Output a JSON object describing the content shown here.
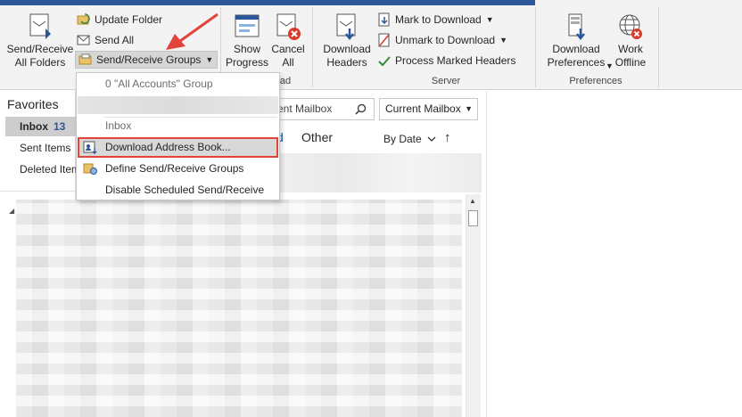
{
  "ribbon": {
    "send_receive_all": "Send/Receive\nAll Folders",
    "update_folder": "Update Folder",
    "send_all": "Send All",
    "send_receive_groups": "Send/Receive Groups",
    "send_receive_group_label_partial": "S",
    "show_progress": "Show\nProgress",
    "cancel_all": "Cancel\nAll",
    "download_group_label_partial": "ad",
    "download_headers": "Download\nHeaders",
    "mark_to_download": "Mark to Download",
    "unmark_to_download": "Unmark to Download",
    "process_marked_headers": "Process Marked Headers",
    "server_group_label": "Server",
    "download_preferences": "Download\nPreferences",
    "work_offline": "Work\nOffline",
    "preferences_group_label": "Preferences"
  },
  "menu": {
    "items": [
      {
        "label": "0 \"All Accounts\" Group"
      },
      {
        "label": "Inbox"
      },
      {
        "label": "Download Address Book..."
      },
      {
        "label": "Define Send/Receive Groups"
      },
      {
        "label": "Disable Scheduled Send/Receive"
      }
    ]
  },
  "nav": {
    "favorites": "Favorites",
    "inbox": "Inbox",
    "inbox_count": "13",
    "sent_items": "Sent Items",
    "deleted_items": "Deleted Item"
  },
  "list": {
    "search_placeholder": "rrent Mailbox",
    "scope": "Current Mailbox",
    "tab_focused_partial": "d",
    "tab_other": "Other",
    "sort_by": "By Date",
    "tab_focused_overlap": ")"
  },
  "colors": {
    "accent": "#2b579a",
    "highlight_border": "#e2433a",
    "arrow": "#e2433a"
  }
}
